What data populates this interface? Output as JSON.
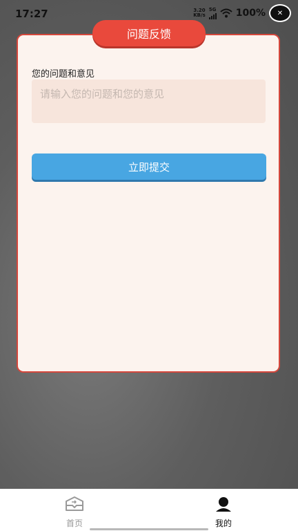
{
  "status_bar": {
    "time": "17:27",
    "net_speed_value": "3.20",
    "net_speed_unit": "KB/s",
    "signal_label": "5G",
    "battery": "100%"
  },
  "feedback": {
    "title": "问题反馈",
    "label": "您的问题和意见",
    "placeholder": "请输入您的问题和您的意见",
    "value": "",
    "submit_label": "立即提交"
  },
  "bottom_nav": {
    "items": [
      {
        "label": "首页",
        "icon": "home-icon",
        "active": false
      },
      {
        "label": "我的",
        "icon": "person-icon",
        "active": true
      }
    ]
  },
  "colors": {
    "accent_red": "#e9493c",
    "submit_blue": "#48a6e2",
    "card_bg": "#fcf3ee"
  }
}
